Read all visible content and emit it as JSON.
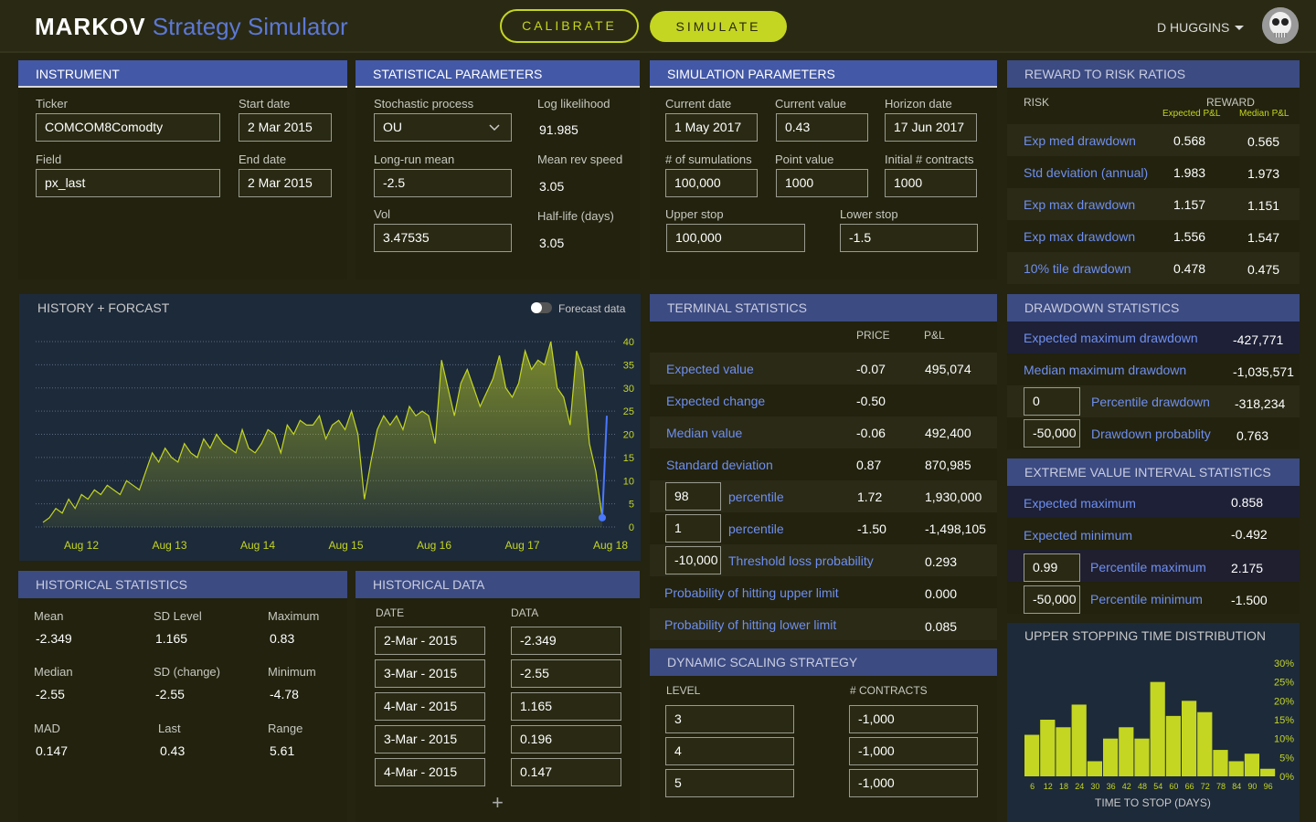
{
  "app": {
    "brand": "MARKOV",
    "title": "Strategy Simulator",
    "calibrate": "CALIBRATE",
    "simulate": "SIMULATE",
    "user": "D HUGGINS"
  },
  "instrument": {
    "title": "INSTRUMENT",
    "ticker_label": "Ticker",
    "ticker": "COMCOM8Comodty",
    "start_label": "Start date",
    "start": "2 Mar 2015",
    "field_label": "Field",
    "field": "px_last",
    "end_label": "End date",
    "end": "2 Mar 2015"
  },
  "stat_params": {
    "title": "STATISTICAL PARAMETERS",
    "process_label": "Stochastic process",
    "process": "OU",
    "loglik_label": "Log likelihood",
    "loglik": "91.985",
    "lrmean_label": "Long-run mean",
    "lrmean": "-2.5",
    "mrs_label": "Mean rev speed",
    "mrs": "3.05",
    "vol_label": "Vol",
    "vol": "3.47535",
    "hl_label": "Half-life (days)",
    "hl": "3.05"
  },
  "sim_params": {
    "title": "SIMULATION PARAMETERS",
    "cdate_label": "Current date",
    "cdate": "1 May 2017",
    "cval_label": "Current value",
    "cval": "0.43",
    "hdate_label": "Horizon date",
    "hdate": "17 Jun 2017",
    "nsim_label": "# of sumulations",
    "nsim": "100,000",
    "pval_label": "Point value",
    "pval": "1000",
    "icon_label": "Initial # contracts",
    "icon": "1000",
    "ustop_label": "Upper stop",
    "ustop": "100,000",
    "lstop_label": "Lower stop",
    "lstop": "-1.5"
  },
  "rr": {
    "title": "REWARD TO RISK RATIOS",
    "risk": "RISK",
    "reward": "REWARD",
    "exp_pl": "Expected P&L",
    "med_pl": "Median P&L",
    "rows": [
      {
        "label": "Exp med drawdown",
        "a": "0.568",
        "b": "0.565"
      },
      {
        "label": "Std deviation (annual)",
        "a": "1.983",
        "b": "1.973"
      },
      {
        "label": "Exp max drawdown",
        "a": "1.157",
        "b": "1.151"
      },
      {
        "label": "Exp max drawdown",
        "a": "1.556",
        "b": "1.547"
      },
      {
        "label": "10% tile drawdown",
        "a": "0.478",
        "b": "0.475"
      }
    ]
  },
  "history": {
    "title": "HISTORY + FORCAST",
    "toggle": "Forecast data"
  },
  "chart_data": [
    {
      "type": "area",
      "title": "HISTORY + FORCAST",
      "categories": [
        "Aug 12",
        "Aug 13",
        "Aug 14",
        "Aug 15",
        "Aug 16",
        "Aug 17",
        "Aug 18"
      ],
      "yticks": [
        "40",
        "35",
        "30",
        "25",
        "20",
        "15",
        "10",
        "5",
        "0"
      ],
      "ylim": [
        0,
        40
      ],
      "values": [
        1,
        2,
        4,
        3,
        6,
        4,
        7,
        6,
        8,
        7,
        9,
        8,
        7,
        10,
        9,
        8,
        12,
        16,
        14,
        17,
        15,
        14,
        18,
        16,
        15,
        19,
        17,
        20,
        18,
        17,
        16,
        21,
        17,
        16,
        18,
        21,
        20,
        16,
        22,
        20,
        23,
        22,
        22,
        24,
        19,
        22,
        23,
        21,
        25,
        20,
        6,
        14,
        21,
        24,
        22,
        24,
        21,
        26,
        24,
        25,
        24,
        18,
        36,
        30,
        24,
        31,
        34,
        30,
        26,
        29,
        32,
        37,
        30,
        28,
        31,
        38,
        34,
        36,
        35,
        40,
        30,
        28,
        22,
        38,
        34,
        18,
        12,
        2
      ],
      "forecast": [
        2,
        24
      ]
    },
    {
      "type": "bar",
      "title": "UPPER STOPPING TIME DISTRIBUTION",
      "xlabel": "TIME TO STOP (DAYS)",
      "categories": [
        "6",
        "12",
        "18",
        "24",
        "30",
        "36",
        "42",
        "48",
        "54",
        "60",
        "66",
        "72",
        "78",
        "84",
        "90",
        "96"
      ],
      "yticks": [
        "30%",
        "25%",
        "20%",
        "15%",
        "10%",
        "5%",
        "0%"
      ],
      "ylim": [
        0,
        30
      ],
      "values": [
        11,
        15,
        13,
        19,
        4,
        10,
        13,
        10,
        25,
        16,
        20,
        17,
        7,
        4,
        6,
        2
      ]
    }
  ],
  "terminal": {
    "title": "TERMINAL STATISTICS",
    "price": "PRICE",
    "pl": "P&L",
    "rows": [
      {
        "label": "Expected value",
        "p": "-0.07",
        "v": "495,074"
      },
      {
        "label": "Expected change",
        "p": "-0.50",
        "v": ""
      },
      {
        "label": "Median value",
        "p": "-0.06",
        "v": "492,400"
      },
      {
        "label": "Standard deviation",
        "p": "0.87",
        "v": "870,985"
      }
    ],
    "pct1": {
      "input": "98",
      "label": "percentile",
      "p": "1.72",
      "v": "1,930,000"
    },
    "pct2": {
      "input": "1",
      "label": "percentile",
      "p": "-1.50",
      "v": "-1,498,105"
    },
    "thr": {
      "input": "-10,000",
      "label": "Threshold loss probability",
      "v": "0.293"
    },
    "upper": {
      "label": "Probability of hitting upper limit",
      "v": "0.000"
    },
    "lower": {
      "label": "Probability of hitting lower limit",
      "v": "0.085"
    }
  },
  "drawdown": {
    "title": "DRAWDOWN STATISTICS",
    "exp_label": "Expected maximum drawdown",
    "exp": "-427,771",
    "med_label": "Median maximum drawdown",
    "med": "-1,035,571",
    "pin": "0",
    "p_label": "Percentile drawdown",
    "p": "-318,234",
    "din": "-50,000",
    "d_label": "Drawdown probablity",
    "d": "0.763"
  },
  "extreme": {
    "title": "EXTREME VALUE INTERVAL STATISTICS",
    "emax_label": "Expected maximum",
    "emax": "0.858",
    "emin_label": "Expected minimum",
    "emin": "-0.492",
    "pmax_in": "0.99",
    "pmax_label": "Percentile maximum",
    "pmax": "2.175",
    "pmin_in": "-50,000",
    "pmin_label": "Percentile minimum",
    "pmin": "-1.500"
  },
  "stopping": {
    "title": "UPPER STOPPING TIME DISTRIBUTION",
    "xlabel": "TIME TO STOP (DAYS)"
  },
  "hist_stats": {
    "title": "HISTORICAL STATISTICS",
    "mean_label": "Mean",
    "mean": "-2.349",
    "sdl_label": "SD Level",
    "sdl": "1.165",
    "max_label": "Maximum",
    "max": "0.83",
    "med_label": "Median",
    "med": "-2.55",
    "sdc_label": "SD (change)",
    "sdc": "-2.55",
    "min_label": "Minimum",
    "min": "-4.78",
    "mad_label": "MAD",
    "mad": "0.147",
    "last_label": "Last",
    "last": "0.43",
    "range_label": "Range",
    "range": "5.61"
  },
  "hist_data": {
    "title": "HISTORICAL DATA",
    "date": "DATE",
    "data": "DATA",
    "add": "+",
    "rows": [
      {
        "d": "2-Mar - 2015",
        "v": "-2.349"
      },
      {
        "d": "3-Mar - 2015",
        "v": "-2.55"
      },
      {
        "d": "4-Mar - 2015",
        "v": "1.165"
      },
      {
        "d": "3-Mar - 2015",
        "v": "0.196"
      },
      {
        "d": "4-Mar - 2015",
        "v": "0.147"
      }
    ]
  },
  "dyn": {
    "title": "DYNAMIC SCALING STRATEGY",
    "level": "LEVEL",
    "contracts": "# CONTRACTS",
    "rows": [
      {
        "l": "3",
        "c": "-1,000"
      },
      {
        "l": "4",
        "c": "-1,000"
      },
      {
        "l": "5",
        "c": "-1,000"
      }
    ]
  }
}
